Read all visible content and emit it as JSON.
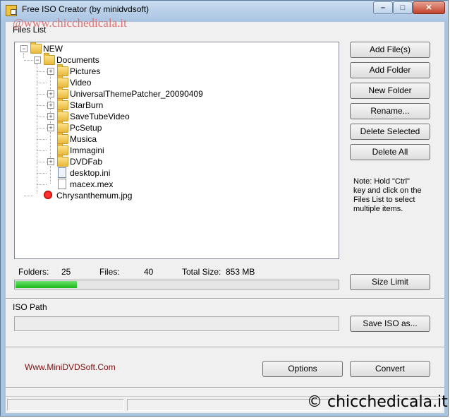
{
  "window": {
    "title": "Free ISO Creator (by minidvdsoft)",
    "watermark": "@www.chicchedicala.it",
    "min_glyph": "–",
    "max_glyph": "□",
    "close_glyph": "✕"
  },
  "files_list": {
    "label": "Files List",
    "tree": [
      {
        "label": "NEW",
        "icon": "folder-icon",
        "expander": "⊟",
        "depth": 0
      },
      {
        "label": "Documents",
        "icon": "folder-icon",
        "expander": "⊟",
        "depth": 1
      },
      {
        "label": "Pictures",
        "icon": "folder-icon",
        "expander": "⊞",
        "depth": 2
      },
      {
        "label": "Video",
        "icon": "folder-icon",
        "expander": "",
        "depth": 2
      },
      {
        "label": "UniversalThemePatcher_20090409",
        "icon": "folder-icon",
        "expander": "⊞",
        "depth": 2
      },
      {
        "label": "StarBurn",
        "icon": "folder-icon",
        "expander": "⊞",
        "depth": 2
      },
      {
        "label": "SaveTubeVideo",
        "icon": "folder-icon",
        "expander": "⊞",
        "depth": 2
      },
      {
        "label": "PcSetup",
        "icon": "folder-icon",
        "expander": "⊞",
        "depth": 2
      },
      {
        "label": "Musica",
        "icon": "folder-icon",
        "expander": "",
        "depth": 2
      },
      {
        "label": "Immagini",
        "icon": "folder-icon",
        "expander": "",
        "depth": 2
      },
      {
        "label": "DVDFab",
        "icon": "folder-icon",
        "expander": "⊞",
        "depth": 2
      },
      {
        "label": "desktop.ini",
        "icon": "settings-file-icon",
        "expander": "",
        "depth": 2
      },
      {
        "label": "macex.mex",
        "icon": "file-icon",
        "expander": "",
        "depth": 2
      },
      {
        "label": "Chrysanthemum.jpg",
        "icon": "image-file-icon",
        "expander": "",
        "depth": 1
      }
    ]
  },
  "buttons": {
    "add_files": "Add File(s)",
    "add_folder": "Add Folder",
    "new_folder": "New Folder",
    "rename": "Rename...",
    "delete_selected": "Delete Selected",
    "delete_all": "Delete All",
    "size_limit": "Size Limit",
    "save_iso": "Save ISO as...",
    "options": "Options",
    "convert": "Convert"
  },
  "note": "Note: Hold \"Ctrl\" key and click on the Files List to select multiple items.",
  "stats": {
    "folders_label": "Folders:",
    "folders_value": "25",
    "files_label": "Files:",
    "files_value": "40",
    "size_label": "Total Size:",
    "size_value": "853 MB"
  },
  "progress": {
    "fraction": 0.19,
    "color": "#18b818"
  },
  "iso_path": {
    "label": "ISO Path",
    "value": ""
  },
  "footer": {
    "site": "Www.MiniDVDSoft.Com",
    "copyright": "© chicchedicala.it"
  }
}
